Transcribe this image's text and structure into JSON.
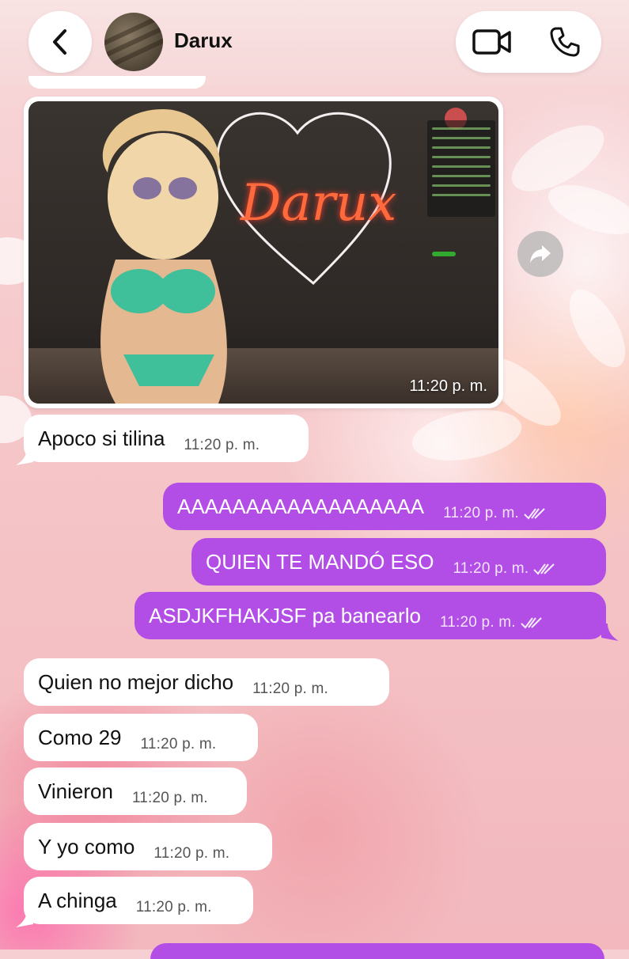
{
  "header": {
    "contact_name": "Darux",
    "back_icon": "chevron-left-icon",
    "video_icon": "video-camera-icon",
    "call_icon": "phone-icon"
  },
  "image_message": {
    "overlay_text": "Darux",
    "timestamp": "11:20 p. m.",
    "forward_icon": "forward-arrow-icon"
  },
  "messages": [
    {
      "direction": "in",
      "text": "Apoco si tilina",
      "time": "11:20 p. m."
    },
    {
      "direction": "out",
      "text": "AAAAAAAAAAAAAAAAAA",
      "time": "11:20 p. m.",
      "status": "read"
    },
    {
      "direction": "out",
      "text": "QUIEN TE MANDÓ ESO",
      "time": "11:20 p. m.",
      "status": "read"
    },
    {
      "direction": "out",
      "text": "ASDJKFHAKJSF pa banearlo",
      "time": "11:20 p. m.",
      "status": "read"
    },
    {
      "direction": "in",
      "text": "Quien no mejor dicho",
      "time": "11:20 p. m."
    },
    {
      "direction": "in",
      "text": "Como 29",
      "time": "11:20 p. m."
    },
    {
      "direction": "in",
      "text": "Vinieron",
      "time": "11:20 p. m."
    },
    {
      "direction": "in",
      "text": "Y yo como",
      "time": "11:20 p. m."
    },
    {
      "direction": "in",
      "text": "A chinga",
      "time": "11:20 p. m."
    }
  ],
  "colors": {
    "outgoing_bubble": "#b24ee6",
    "incoming_bubble": "#ffffff"
  }
}
